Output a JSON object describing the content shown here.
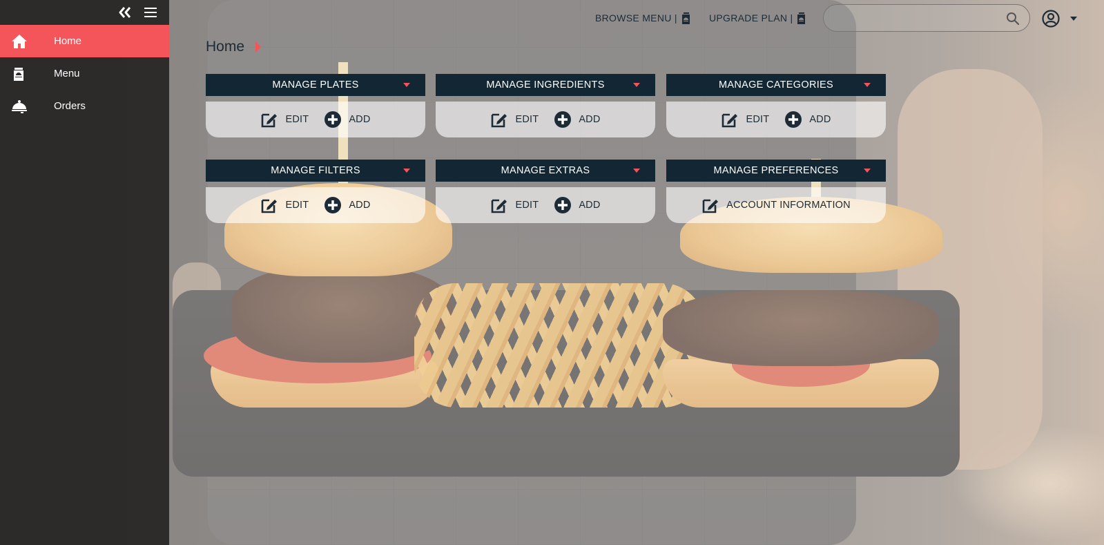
{
  "sidebar": {
    "items": [
      {
        "label": "Home",
        "icon": "home-icon",
        "active": true
      },
      {
        "label": "Menu",
        "icon": "menu-book-icon",
        "active": false
      },
      {
        "label": "Orders",
        "icon": "cloche-icon",
        "active": false
      }
    ]
  },
  "header": {
    "browse_menu": "BROWSE MENU |",
    "upgrade_plan": "UPGRADE PLAN |",
    "search_placeholder": ""
  },
  "page": {
    "title": "Home"
  },
  "cards": [
    {
      "title": "MANAGE PLATES",
      "actions": [
        "EDIT",
        "ADD"
      ]
    },
    {
      "title": "MANAGE INGREDIENTS",
      "actions": [
        "EDIT",
        "ADD"
      ]
    },
    {
      "title": "MANAGE CATEGORIES",
      "actions": [
        "EDIT",
        "ADD"
      ]
    },
    {
      "title": "MANAGE FILTERS",
      "actions": [
        "EDIT",
        "ADD"
      ]
    },
    {
      "title": "MANAGE EXTRAS",
      "actions": [
        "EDIT",
        "ADD"
      ]
    },
    {
      "title": "MANAGE PREFERENCES",
      "actions": [
        "ACCOUNT INFORMATION"
      ]
    }
  ],
  "colors": {
    "accent": "#f4555a",
    "card_header": "#122634",
    "text_dark": "#1c2b36",
    "sidebar_bg": "#282625"
  }
}
